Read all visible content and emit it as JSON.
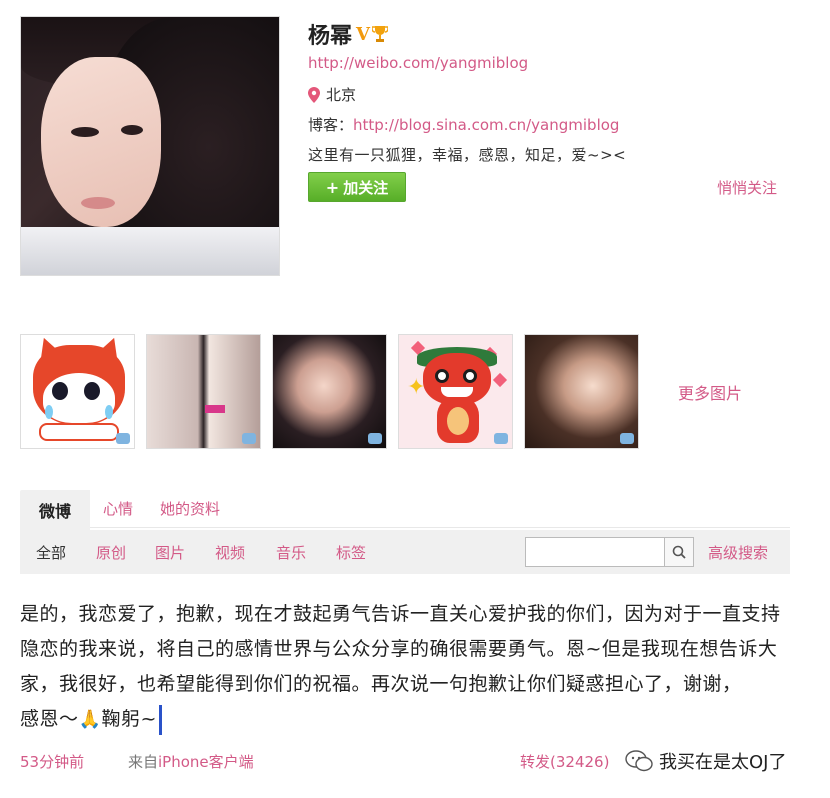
{
  "profile": {
    "name": "杨幂",
    "verified_badge": "V",
    "weibo_url": "http://weibo.com/yangmiblog",
    "location": "北京",
    "blog_label": "博客：",
    "blog_url": "http://blog.sina.com.cn/yangmiblog",
    "bio": "这里有一只狐狸，幸福，感恩，知足，爱~><",
    "follow_button": "加关注",
    "quiet_follow": "悄悄关注"
  },
  "photos": {
    "more_label": "更多图片"
  },
  "tabs": {
    "items": [
      "微博",
      "心情",
      "她的资料"
    ],
    "active": "微博"
  },
  "filters": {
    "items": [
      "全部",
      "原创",
      "图片",
      "视频",
      "音乐",
      "标签"
    ],
    "search_placeholder": "",
    "advanced_search": "高级搜索"
  },
  "post": {
    "text": "是的，我恋爱了，抱歉，现在才鼓起勇气告诉一直关心爱护我的你们，因为对于一直支持隐恋的我来说，将自己的感情世界与公众分享的确很需要勇气。恩~但是我现在想告诉大家，我很好，也希望能得到你们的祝福。再次说一句抱歉让你们疑惑担心了，谢谢，",
    "text_end_before": "感恩～",
    "text_end_after": "鞠躬~",
    "time": "53分钟前",
    "source_prefix": "来自",
    "source_link": "iPhone客户端",
    "forward": "转发(32426)"
  },
  "watermark": {
    "text": "我买在是太OJ了"
  },
  "colors": {
    "link": "#d35a87",
    "follow_green": "#57ae28",
    "tab_bg": "#f0f0f0"
  },
  "icons": [
    "location-pin-icon",
    "trophy-icon",
    "plus-icon",
    "search-icon",
    "comment-bubble-icon",
    "pray-hands-icon",
    "wechat-icon"
  ]
}
